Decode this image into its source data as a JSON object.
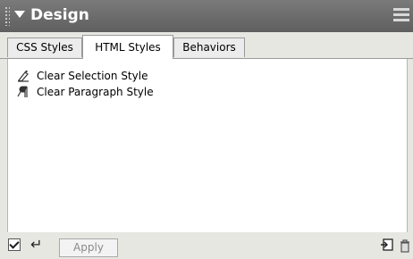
{
  "panel": {
    "title": "Design"
  },
  "tabs": [
    {
      "label": "CSS Styles",
      "active": false
    },
    {
      "label": "HTML Styles",
      "active": true
    },
    {
      "label": "Behaviors",
      "active": false
    }
  ],
  "list": {
    "items": [
      {
        "label": "Clear Selection Style",
        "icon": "clear-selection-style-icon"
      },
      {
        "label": "Clear Paragraph Style",
        "icon": "clear-paragraph-style-icon"
      }
    ]
  },
  "footer": {
    "auto_apply_checked": true,
    "apply_label": "Apply"
  }
}
